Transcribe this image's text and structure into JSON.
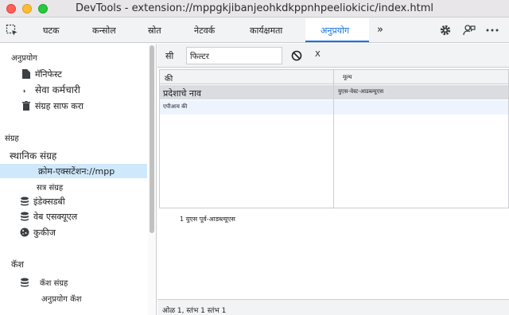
{
  "window": {
    "title": "DevTools - extension://mppgkjibanjeohkdkppnhpeeliokicic/index.html"
  },
  "tabs": [
    {
      "label": "घटक"
    },
    {
      "label": "कन्सोल"
    },
    {
      "label": "स्रोत"
    },
    {
      "label": "नेटवर्क"
    },
    {
      "label": "कार्यक्षमता"
    },
    {
      "label": "अनुप्रयोग"
    },
    {
      "label": "»"
    }
  ],
  "toolbar_icons": [
    "inspect-icon",
    "gear-icon",
    "feedback-icon",
    "more-icon"
  ],
  "sidebar": {
    "app_section": "अनुप्रयोग",
    "app_items": [
      {
        "label": "मॅनिफेस्ट",
        "icon": "file-icon"
      },
      {
        "label": "सेवा कर्मचारी",
        "icon": "gear-icon"
      },
      {
        "label": "संग्रह साफ करा",
        "icon": "trash-icon"
      }
    ],
    "storage_section": "संग्रह",
    "local_storage": "स्थानिक संग्रह",
    "selected_origin": "क्रोम-एक्सटेंशन://mpp",
    "session_storage": "सत्र संग्रह",
    "storage_items": [
      {
        "label": "इंडेक्सडबी",
        "icon": "database-icon"
      },
      {
        "label": "वेब एसक्यूएल",
        "icon": "database-icon"
      },
      {
        "label": "कुकीज",
        "icon": "cookie-icon"
      }
    ],
    "cache_section": "कॅश",
    "cache_storage": "कॅश संग्रह",
    "app_cache": "अनुप्रयोग कॅश"
  },
  "main": {
    "si_label": "सी",
    "filter_placeholder": "फिल्टर",
    "toolbar_x": "X",
    "columns": {
      "key": "की",
      "value": "मूल्य"
    },
    "rows": [
      {
        "key": "प्रदेशाचे नाव",
        "value": "युएस-वेस्ट-आडब्ल्यूएस"
      },
      {
        "key": "एपीआय की",
        "value": ""
      }
    ],
    "detail_text": "1 युएस पूर्व-आडब्ल्यूएस",
    "status_text": "ओळ 1, स्तंभ 1 स्तंभ 1"
  }
}
